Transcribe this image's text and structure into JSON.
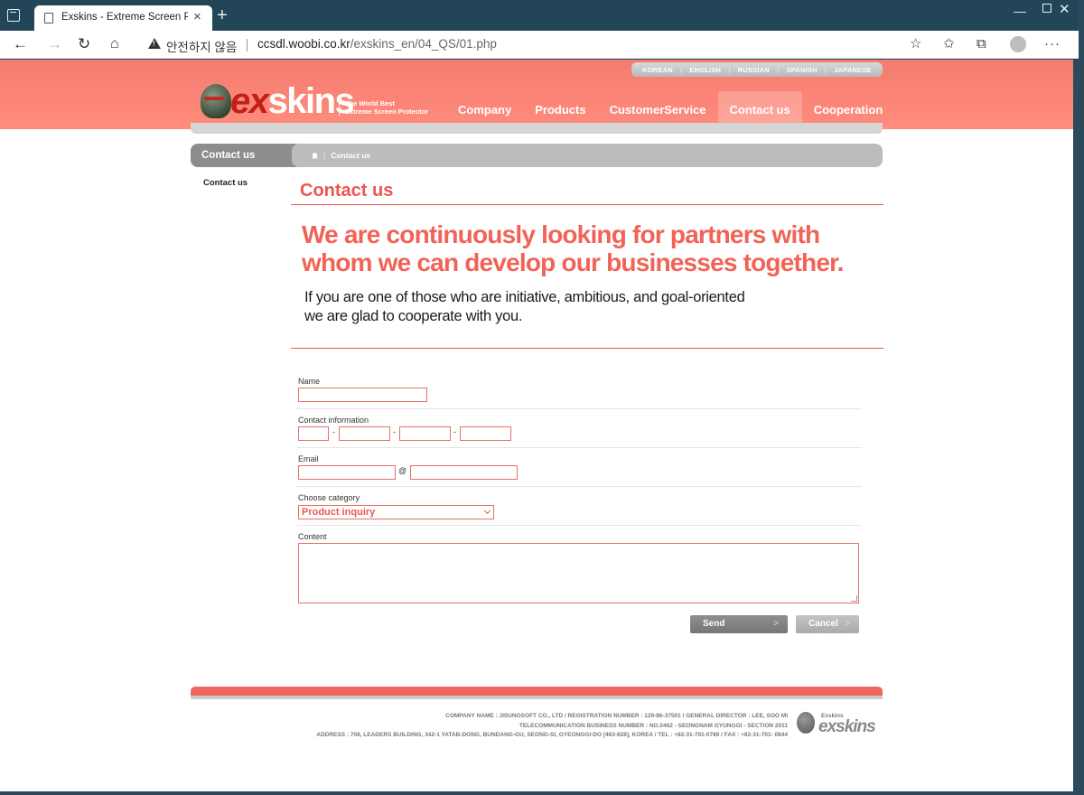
{
  "browser": {
    "tab_title": "Exskins - Extreme Screen Protect",
    "address_warning": "안전하지 않음",
    "url_host": "ccsdl.woobi.co.kr",
    "url_path": "/exskins_en/04_QS/01.php"
  },
  "header": {
    "languages": [
      "KOREAN",
      "ENGLISH",
      "RUSSIAN",
      "SPANISH",
      "JAPANESE"
    ],
    "logo_ex": "ex",
    "logo_skins": "skins",
    "tagline_1": "The World Best",
    "tagline_2": "Extreme Screen Protector",
    "nav": [
      "Company",
      "Products",
      "CustomerService",
      "Contact us",
      "Cooperation"
    ]
  },
  "subheader": {
    "section_title": "Contact us",
    "breadcrumb": "Contact us"
  },
  "sidebar": {
    "items": [
      "Contact us"
    ]
  },
  "content": {
    "title": "Contact us",
    "headline_1": "We are continuously looking for partners with",
    "headline_2": "whom we can develop our businesses together.",
    "subline_1": "If you are one of those who are initiative, ambitious, and goal-oriented",
    "subline_2": "we are glad to cooperate with you."
  },
  "form": {
    "name_label": "Name",
    "contact_label": "Contact information",
    "email_label": "Email",
    "at_sign": "@",
    "dash": "-",
    "category_label": "Choose category",
    "category_value": "Product inquiry",
    "content_label": "Content",
    "send": "Send",
    "cancel": "Cancel",
    "chevron": ">"
  },
  "footer": {
    "line_1": "COMPANY NAME : JISUNGSOFT CO., LTD / REGISTRATION NUMBER : 129-86-37501 / GENERAL DIRECTOR : LEE, SOO MI",
    "line_2": "TELECOMMUNICATION BUSINESS NUMBER : NO.0462 - SEONGNAM GYUNGGI - SECTION 2011",
    "line_3": "ADDRESS : 708, LEADERS BUILDING, 342-1 YATAB-DONG, BUNDANG-GU, SEONG-SI, GYEONGGI-DO [463-828], KOREA / TEL : +82-31-701-0789 / FAX : +82-31-701- 0844",
    "logo_small": "Exskins",
    "logo_text": "exskins"
  }
}
